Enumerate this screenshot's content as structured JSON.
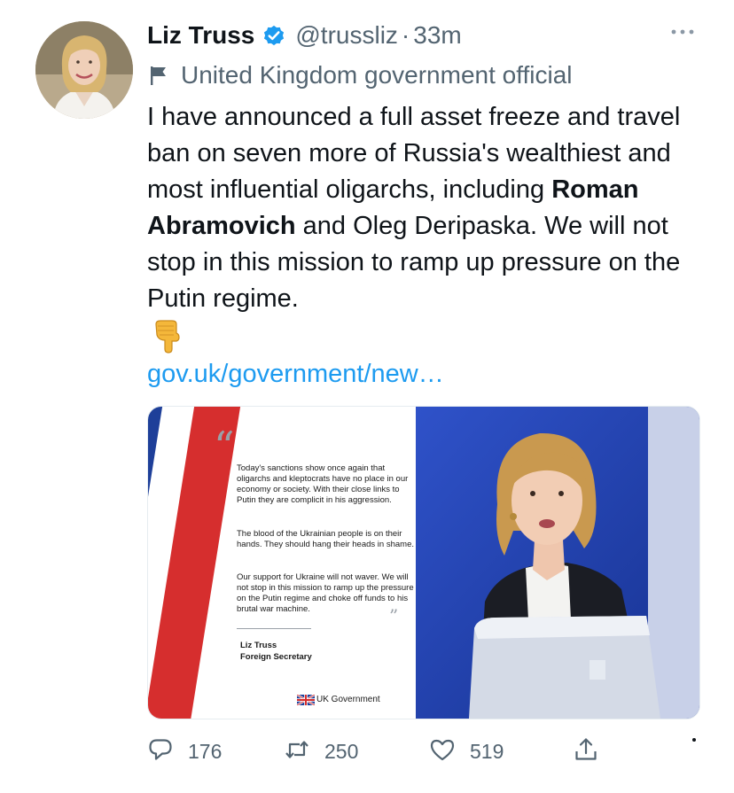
{
  "tweet": {
    "author_name": "Liz Truss",
    "handle": "@trussliz",
    "separator": "·",
    "time": "33m",
    "label": "United Kingdom government official",
    "text_part1": "I have announced a full asset freeze and travel ban on seven more of Russia's wealthiest and most influential oligarchs, including ",
    "text_bold": "Roman Abramovich",
    "text_part2": " and Oleg Deripaska. We will not stop in this mission to ramp up pressure on the Putin regime.",
    "emoji": "👇",
    "link": "gov.uk/government/new…"
  },
  "media": {
    "quote_open": "“",
    "quote_close": "”",
    "paragraph1": "Today's sanctions show once again that oligarchs and kleptocrats have no place in our economy or society. With their close links to Putin they are complicit in his aggression.",
    "paragraph2": "The blood of the Ukrainian people is on their hands. They should hang their heads in shame.",
    "paragraph3": "Our support for Ukraine will not waver. We will not stop in this mission to ramp up the pressure on the Putin regime and choke off funds to his brutal war machine.",
    "signature_name": "Liz Truss",
    "signature_title": "Foreign Secretary",
    "brand": "UK Government"
  },
  "actions": {
    "replies": "176",
    "retweets": "250",
    "likes": "519"
  },
  "colors": {
    "accent": "#1d9bf0",
    "secondary_text": "#536471",
    "flag_red": "#d62e2e",
    "flag_blue": "#1e3f99"
  },
  "icons": [
    "verified-badge-icon",
    "more-options-icon",
    "government-flag-icon",
    "reply-icon",
    "retweet-icon",
    "like-icon",
    "share-icon"
  ]
}
